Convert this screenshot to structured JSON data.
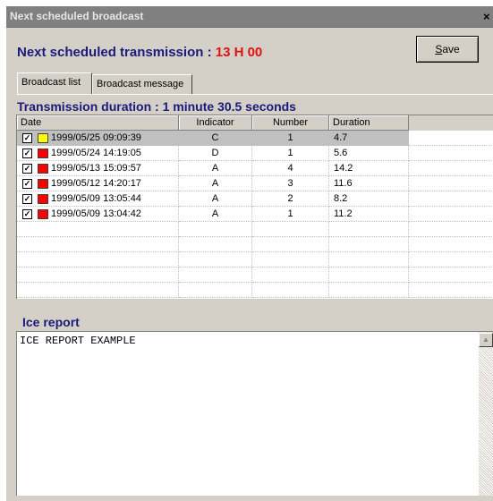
{
  "window": {
    "title": "Next scheduled  broadcast",
    "close_glyph": "×",
    "close_icon": "close-icon"
  },
  "header": {
    "label": "Next scheduled transmission : ",
    "time": "13 H 00",
    "save_label": "Save"
  },
  "tabs": [
    {
      "label": "Broadcast list",
      "active": true
    },
    {
      "label": "Broadcast message",
      "active": false
    }
  ],
  "transmission": {
    "title": "Transmission duration : 1 minute 30.5 seconds"
  },
  "table": {
    "columns": [
      "Date",
      "Indicator",
      "Number",
      "Duration"
    ],
    "rows": [
      {
        "checked": true,
        "color": "#ffff00",
        "date": "1999/05/25 09:09:39",
        "indicator": "C",
        "number": "1",
        "duration": "4.7",
        "selected": true
      },
      {
        "checked": true,
        "color": "#ff0000",
        "date": "1999/05/24 14:19:05",
        "indicator": "D",
        "number": "1",
        "duration": "5.6",
        "selected": false
      },
      {
        "checked": true,
        "color": "#ff0000",
        "date": "1999/05/13 15:09:57",
        "indicator": "A",
        "number": "4",
        "duration": "14.2",
        "selected": false
      },
      {
        "checked": true,
        "color": "#ff0000",
        "date": "1999/05/12 14:20:17",
        "indicator": "A",
        "number": "3",
        "duration": "11.6",
        "selected": false
      },
      {
        "checked": true,
        "color": "#ff0000",
        "date": "1999/05/09 13:05:44",
        "indicator": "A",
        "number": "2",
        "duration": "8.2",
        "selected": false
      },
      {
        "checked": true,
        "color": "#ff0000",
        "date": "1999/05/09 13:04:42",
        "indicator": "A",
        "number": "1",
        "duration": "11.2",
        "selected": false
      }
    ],
    "check_glyph": "✓"
  },
  "ice_report": {
    "title": "Ice report",
    "content": "ICE REPORT EXAMPLE"
  },
  "colors": {
    "title_text": "#1a1a7a",
    "time_text": "#e01010",
    "face": "#d4d0c8",
    "selection": "#c0c0c0"
  }
}
